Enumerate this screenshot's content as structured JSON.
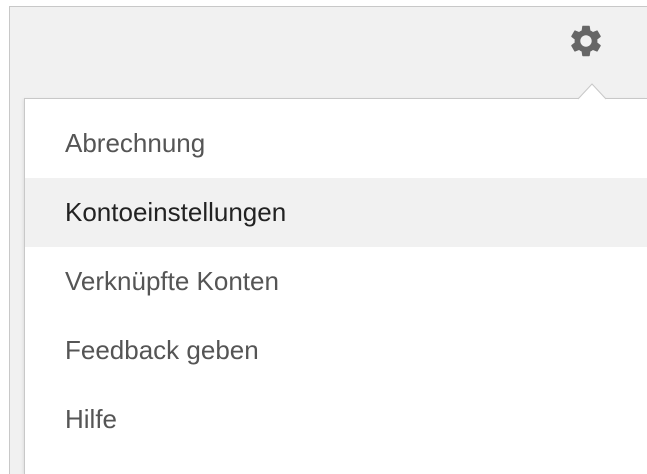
{
  "toolbar": {
    "settings_icon": "gear-icon"
  },
  "menu": {
    "items": [
      {
        "label": "Abrechnung",
        "active": false
      },
      {
        "label": "Kontoeinstellungen",
        "active": true
      },
      {
        "label": "Verknüpfte Konten",
        "active": false
      },
      {
        "label": "Feedback geben",
        "active": false
      },
      {
        "label": "Hilfe",
        "active": false
      }
    ]
  },
  "colors": {
    "background": "#f1f1f1",
    "menu_background": "#ffffff",
    "hover_background": "#f1f1f1",
    "text": "#555555",
    "active_text": "#222222",
    "icon": "#666666",
    "border": "#c8c8c8"
  }
}
